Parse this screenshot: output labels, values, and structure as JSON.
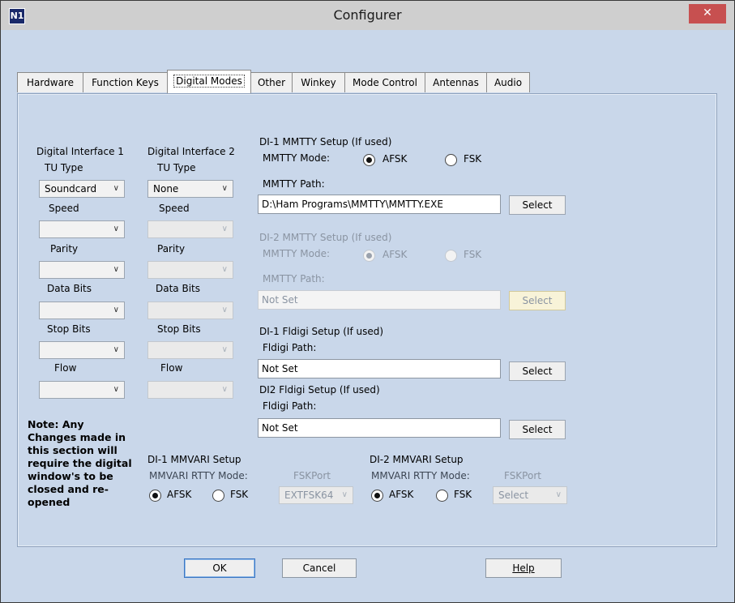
{
  "window": {
    "title": "Configurer",
    "close_glyph": "✕",
    "icon_text": "N1"
  },
  "tabs": [
    "Hardware",
    "Function Keys",
    "Digital Modes",
    "Other",
    "Winkey",
    "Mode Control",
    "Antennas",
    "Audio"
  ],
  "di1": {
    "heading": "Digital Interface 1",
    "tu_label": "TU Type",
    "tu_value": "Soundcard",
    "speed_label": "Speed",
    "parity_label": "Parity",
    "databits_label": "Data Bits",
    "stopbits_label": "Stop Bits",
    "flow_label": "Flow"
  },
  "di2": {
    "heading": "Digital Interface 2",
    "tu_label": "TU Type",
    "tu_value": "None",
    "speed_label": "Speed",
    "parity_label": "Parity",
    "databits_label": "Data Bits",
    "stopbits_label": "Stop Bits",
    "flow_label": "Flow"
  },
  "mmtty1": {
    "heading": "DI-1 MMTTY Setup (If used)",
    "mode_label": "MMTTY Mode:",
    "afsk": "AFSK",
    "fsk": "FSK",
    "selected": "AFSK",
    "path_label": "MMTTY Path:",
    "path_value": "D:\\Ham Programs\\MMTTY\\MMTTY.EXE",
    "select_label": "Select"
  },
  "mmtty2": {
    "heading": "DI-2 MMTTY Setup (If used)",
    "mode_label": "MMTTY Mode:",
    "afsk": "AFSK",
    "fsk": "FSK",
    "selected": "AFSK",
    "path_label": "MMTTY Path:",
    "path_value": "Not Set",
    "select_label": "Select"
  },
  "fldigi1": {
    "heading": "DI-1 Fldigi Setup (If used)",
    "path_label": "Fldigi Path:",
    "path_value": "Not Set",
    "select_label": "Select"
  },
  "fldigi2": {
    "heading": "DI2 Fldigi Setup (If used)",
    "path_label": "Fldigi Path:",
    "path_value": "Not Set",
    "select_label": "Select"
  },
  "note": "Note: Any Changes made in this section will require the digital window's to be closed and re-opened",
  "mmvari1": {
    "heading": "DI-1 MMVARI Setup",
    "mode_label": "MMVARI RTTY Mode:",
    "afsk": "AFSK",
    "fsk": "FSK",
    "selected": "AFSK",
    "port_label": "FSKPort",
    "port_value": "EXTFSK64"
  },
  "mmvari2": {
    "heading": "DI-2 MMVARI Setup",
    "mode_label": "MMVARI RTTY Mode:",
    "afsk": "AFSK",
    "fsk": "FSK",
    "selected": "AFSK",
    "port_label": "FSKPort",
    "port_value": "Select"
  },
  "footer": {
    "ok": "OK",
    "cancel": "Cancel",
    "help": "Help"
  },
  "icons": {
    "dropdown": "chevron-down-icon",
    "close": "close-icon"
  },
  "colors": {
    "panel": "#c9d7ea",
    "disabled_text": "#8a94a2",
    "close": "#c75050"
  }
}
